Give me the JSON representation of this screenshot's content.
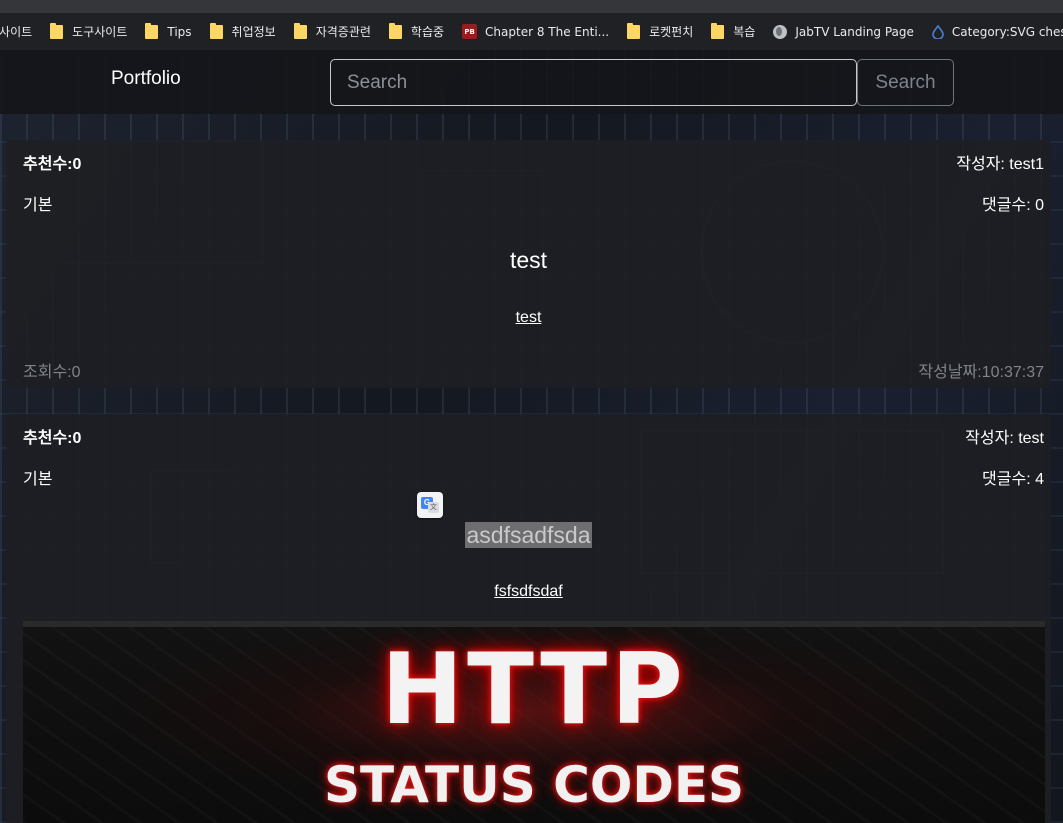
{
  "bookmarks": [
    {
      "label": "툰사이트",
      "icon": "folder-icon"
    },
    {
      "label": "도구사이트",
      "icon": "folder-icon"
    },
    {
      "label": "Tips",
      "icon": "folder-icon"
    },
    {
      "label": "취업정보",
      "icon": "folder-icon"
    },
    {
      "label": "자격증관련",
      "icon": "folder-icon"
    },
    {
      "label": "학습중",
      "icon": "folder-icon"
    },
    {
      "label": "Chapter 8 The Enti...",
      "icon": "pb-site-icon",
      "icon_text": "PB"
    },
    {
      "label": "로켓펀치",
      "icon": "folder-icon"
    },
    {
      "label": "복습",
      "icon": "folder-icon"
    },
    {
      "label": "JabTV Landing Page",
      "icon": "globe-icon"
    },
    {
      "label": "Category:SVG ches",
      "icon": "blue-drop-icon"
    }
  ],
  "navbar": {
    "brand": "Portfolio",
    "search_placeholder": "Search",
    "search_button": "Search"
  },
  "posts": [
    {
      "likes": "추천수:0",
      "author": "작성자: test1",
      "category": "기본",
      "comments": "댓글수: 0",
      "title": "test",
      "content_link": "test",
      "views": "조회수:0",
      "date": "작성날짜:10:37:37"
    },
    {
      "likes": "추천수:0",
      "author": "작성자: test",
      "category": "기본",
      "comments": "댓글수: 4",
      "title": "asdfsadfsda",
      "content_link": "fsfsdfsdaf",
      "image": {
        "line1": "HTTP",
        "line2": "STATUS CODES"
      }
    }
  ],
  "translate_icon": {
    "g": "G",
    "x": "文"
  },
  "colors": {
    "bookmark_bar": "#202124",
    "folder": "#fdd663",
    "card_bg": "#1e1f23",
    "muted_text": "#7f8489",
    "glow_red": "#c40000"
  }
}
